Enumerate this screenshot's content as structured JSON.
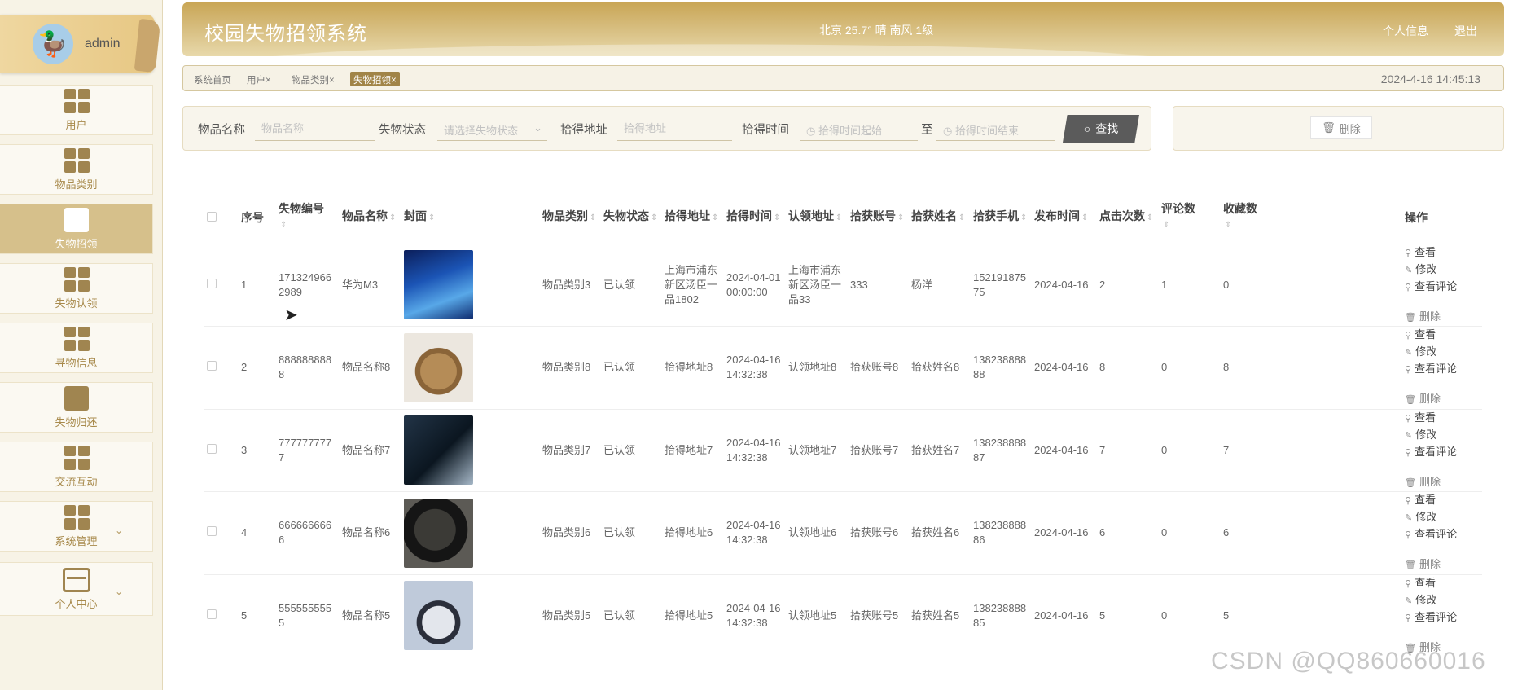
{
  "user": {
    "name": "admin"
  },
  "sidebar": {
    "items": [
      {
        "label": "用户",
        "icon": "grid-icon"
      },
      {
        "label": "物品类别",
        "icon": "grid-icon"
      },
      {
        "label": "失物招领",
        "icon": "briefcase-icon",
        "active": true
      },
      {
        "label": "失物认领",
        "icon": "grid-icon"
      },
      {
        "label": "寻物信息",
        "icon": "grid-icon"
      },
      {
        "label": "失物归还",
        "icon": "chart-icon"
      },
      {
        "label": "交流互动",
        "icon": "grid-icon"
      },
      {
        "label": "系统管理",
        "icon": "grid-icon",
        "expandable": true
      },
      {
        "label": "个人中心",
        "icon": "card-icon",
        "expandable": true
      }
    ]
  },
  "header": {
    "title": "校园失物招领系统",
    "weather": "北京  25.7°  晴  南风  1级",
    "profile_label": "个人信息",
    "logout_label": "退出"
  },
  "tabs": [
    {
      "label": "系统首页",
      "closable": false
    },
    {
      "label": "用户",
      "closable": true
    },
    {
      "label": "物品类别",
      "closable": true
    },
    {
      "label": "失物招领",
      "closable": true,
      "active": true
    }
  ],
  "tab_close_glyph": "×",
  "datetime": "2024-4-16 14:45:13",
  "search": {
    "item_name_label": "物品名称",
    "item_name_placeholder": "物品名称",
    "status_label": "失物状态",
    "status_placeholder": "请选择失物状态",
    "address_label": "拾得地址",
    "address_placeholder": "拾得地址",
    "time_label": "拾得时间",
    "time_start_placeholder": "拾得时间起始",
    "to_label": "至",
    "time_end_placeholder": "拾得时间结束",
    "find_label": "查找"
  },
  "actions": {
    "delete_label": "删除"
  },
  "table": {
    "headers": [
      "序号",
      "失物编号",
      "物品名称",
      "封面",
      "物品类别",
      "失物状态",
      "拾得地址",
      "拾得时间",
      "认领地址",
      "拾获账号",
      "拾获姓名",
      "拾获手机",
      "发布时间",
      "点击次数",
      "评论数",
      "收藏数",
      "操作"
    ],
    "rows": [
      {
        "no": "1",
        "code": "1713249662989",
        "name": "华为M3",
        "category": "物品类别3",
        "status": "已认领",
        "address": "上海市浦东新区汤臣一品1802",
        "time": "2024-04-01 00:00:00",
        "claim_address": "上海市浦东新区汤臣一品33",
        "account": "333",
        "finder": "杨洋",
        "phone": "15219187575",
        "publish": "2024-04-16",
        "clicks": "2",
        "comments": "1",
        "favorites": "0"
      },
      {
        "no": "2",
        "code": "8888888888",
        "name": "物品名称8",
        "category": "物品类别8",
        "status": "已认领",
        "address": "拾得地址8",
        "time": "2024-04-16 14:32:38",
        "claim_address": "认领地址8",
        "account": "拾获账号8",
        "finder": "拾获姓名8",
        "phone": "13823888888",
        "publish": "2024-04-16",
        "clicks": "8",
        "comments": "0",
        "favorites": "8"
      },
      {
        "no": "3",
        "code": "7777777777",
        "name": "物品名称7",
        "category": "物品类别7",
        "status": "已认领",
        "address": "拾得地址7",
        "time": "2024-04-16 14:32:38",
        "claim_address": "认领地址7",
        "account": "拾获账号7",
        "finder": "拾获姓名7",
        "phone": "13823888887",
        "publish": "2024-04-16",
        "clicks": "7",
        "comments": "0",
        "favorites": "7"
      },
      {
        "no": "4",
        "code": "6666666666",
        "name": "物品名称6",
        "category": "物品类别6",
        "status": "已认领",
        "address": "拾得地址6",
        "time": "2024-04-16 14:32:38",
        "claim_address": "认领地址6",
        "account": "拾获账号6",
        "finder": "拾获姓名6",
        "phone": "13823888886",
        "publish": "2024-04-16",
        "clicks": "6",
        "comments": "0",
        "favorites": "6"
      },
      {
        "no": "5",
        "code": "5555555555",
        "name": "物品名称5",
        "category": "物品类别5",
        "status": "已认领",
        "address": "拾得地址5",
        "time": "2024-04-16 14:32:38",
        "claim_address": "认领地址5",
        "account": "拾获账号5",
        "finder": "拾获姓名5",
        "phone": "13823888885",
        "publish": "2024-04-16",
        "clicks": "5",
        "comments": "0",
        "favorites": "5"
      }
    ],
    "ops": {
      "view": "查看",
      "edit": "修改",
      "comments": "查看评论",
      "delete": "删除"
    }
  },
  "watermark": "CSDN @QQ860660016",
  "colors": {
    "accent": "#a18447",
    "header_gold": "#c9a656",
    "active_menu": "#d6c08b"
  }
}
